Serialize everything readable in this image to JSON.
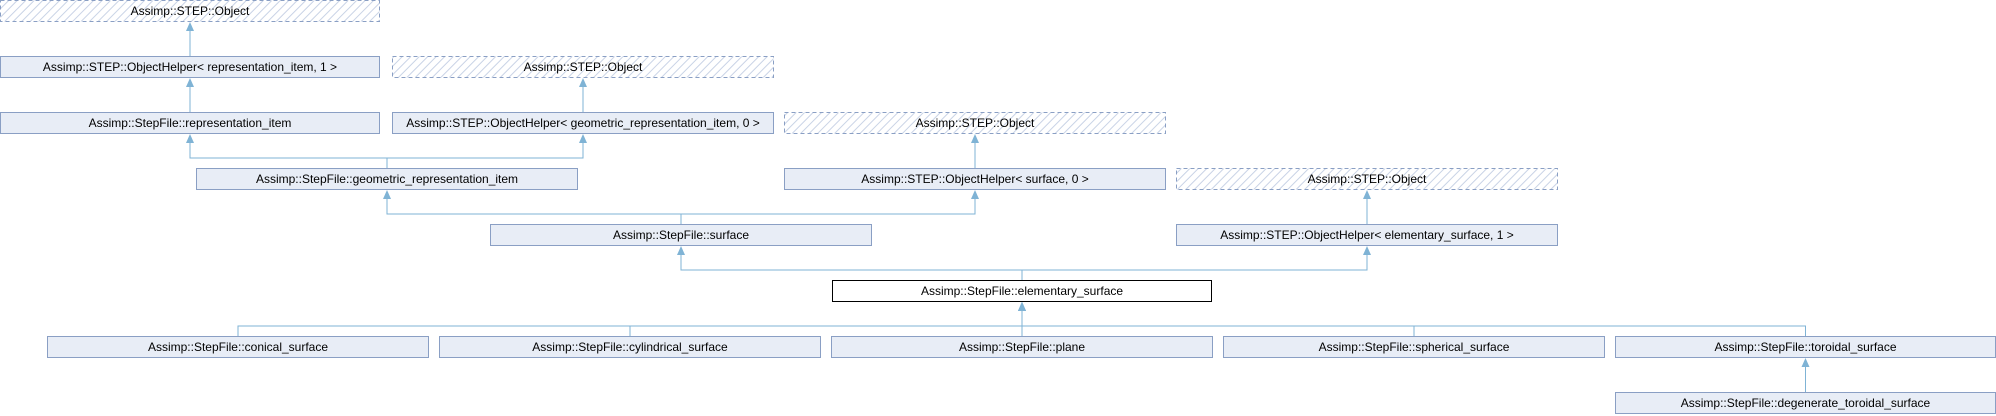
{
  "diagram": {
    "type": "inheritance-graph",
    "colors": {
      "node_fill": "#e8edf6",
      "node_border": "#8a9fc4",
      "current_fill": "#ffffff",
      "current_border": "#000000",
      "hidden_border": "#8a9fc4",
      "hatch": "#c9d3e6",
      "edge": "#7fb3d5"
    },
    "nodes": [
      {
        "id": "obj1",
        "label": "Assimp::STEP::Object",
        "style": "hidden"
      },
      {
        "id": "oh_rep",
        "label": "Assimp::STEP::ObjectHelper< representation_item, 1 >",
        "style": "normal"
      },
      {
        "id": "obj2",
        "label": "Assimp::STEP::Object",
        "style": "hidden"
      },
      {
        "id": "rep_item",
        "label": "Assimp::StepFile::representation_item",
        "style": "normal"
      },
      {
        "id": "oh_geo",
        "label": "Assimp::STEP::ObjectHelper< geometric_representation_item, 0 >",
        "style": "normal"
      },
      {
        "id": "obj3",
        "label": "Assimp::STEP::Object",
        "style": "hidden"
      },
      {
        "id": "geo_rep",
        "label": "Assimp::StepFile::geometric_representation_item",
        "style": "normal"
      },
      {
        "id": "oh_surf",
        "label": "Assimp::STEP::ObjectHelper< surface, 0 >",
        "style": "normal"
      },
      {
        "id": "obj4",
        "label": "Assimp::STEP::Object",
        "style": "hidden"
      },
      {
        "id": "surface",
        "label": "Assimp::StepFile::surface",
        "style": "normal"
      },
      {
        "id": "oh_elem",
        "label": "Assimp::STEP::ObjectHelper< elementary_surface, 1 >",
        "style": "normal"
      },
      {
        "id": "elem",
        "label": "Assimp::StepFile::elementary_surface",
        "style": "current"
      },
      {
        "id": "conical",
        "label": "Assimp::StepFile::conical_surface",
        "style": "normal"
      },
      {
        "id": "cyl",
        "label": "Assimp::StepFile::cylindrical_surface",
        "style": "normal"
      },
      {
        "id": "plane",
        "label": "Assimp::StepFile::plane",
        "style": "normal"
      },
      {
        "id": "spher",
        "label": "Assimp::StepFile::spherical_surface",
        "style": "normal"
      },
      {
        "id": "toroid",
        "label": "Assimp::StepFile::toroidal_surface",
        "style": "normal"
      },
      {
        "id": "degen",
        "label": "Assimp::StepFile::degenerate_toroidal_surface",
        "style": "normal"
      }
    ],
    "edges": [
      {
        "from": "oh_rep",
        "to": "obj1"
      },
      {
        "from": "rep_item",
        "to": "oh_rep"
      },
      {
        "from": "oh_geo",
        "to": "obj2"
      },
      {
        "from": "geo_rep",
        "to": "rep_item"
      },
      {
        "from": "geo_rep",
        "to": "oh_geo"
      },
      {
        "from": "oh_surf",
        "to": "obj3"
      },
      {
        "from": "surface",
        "to": "geo_rep"
      },
      {
        "from": "surface",
        "to": "oh_surf"
      },
      {
        "from": "oh_elem",
        "to": "obj4"
      },
      {
        "from": "elem",
        "to": "surface"
      },
      {
        "from": "elem",
        "to": "oh_elem"
      },
      {
        "from": "conical",
        "to": "elem"
      },
      {
        "from": "cyl",
        "to": "elem"
      },
      {
        "from": "plane",
        "to": "elem"
      },
      {
        "from": "spher",
        "to": "elem"
      },
      {
        "from": "toroid",
        "to": "elem"
      },
      {
        "from": "degen",
        "to": "toroid"
      }
    ]
  }
}
